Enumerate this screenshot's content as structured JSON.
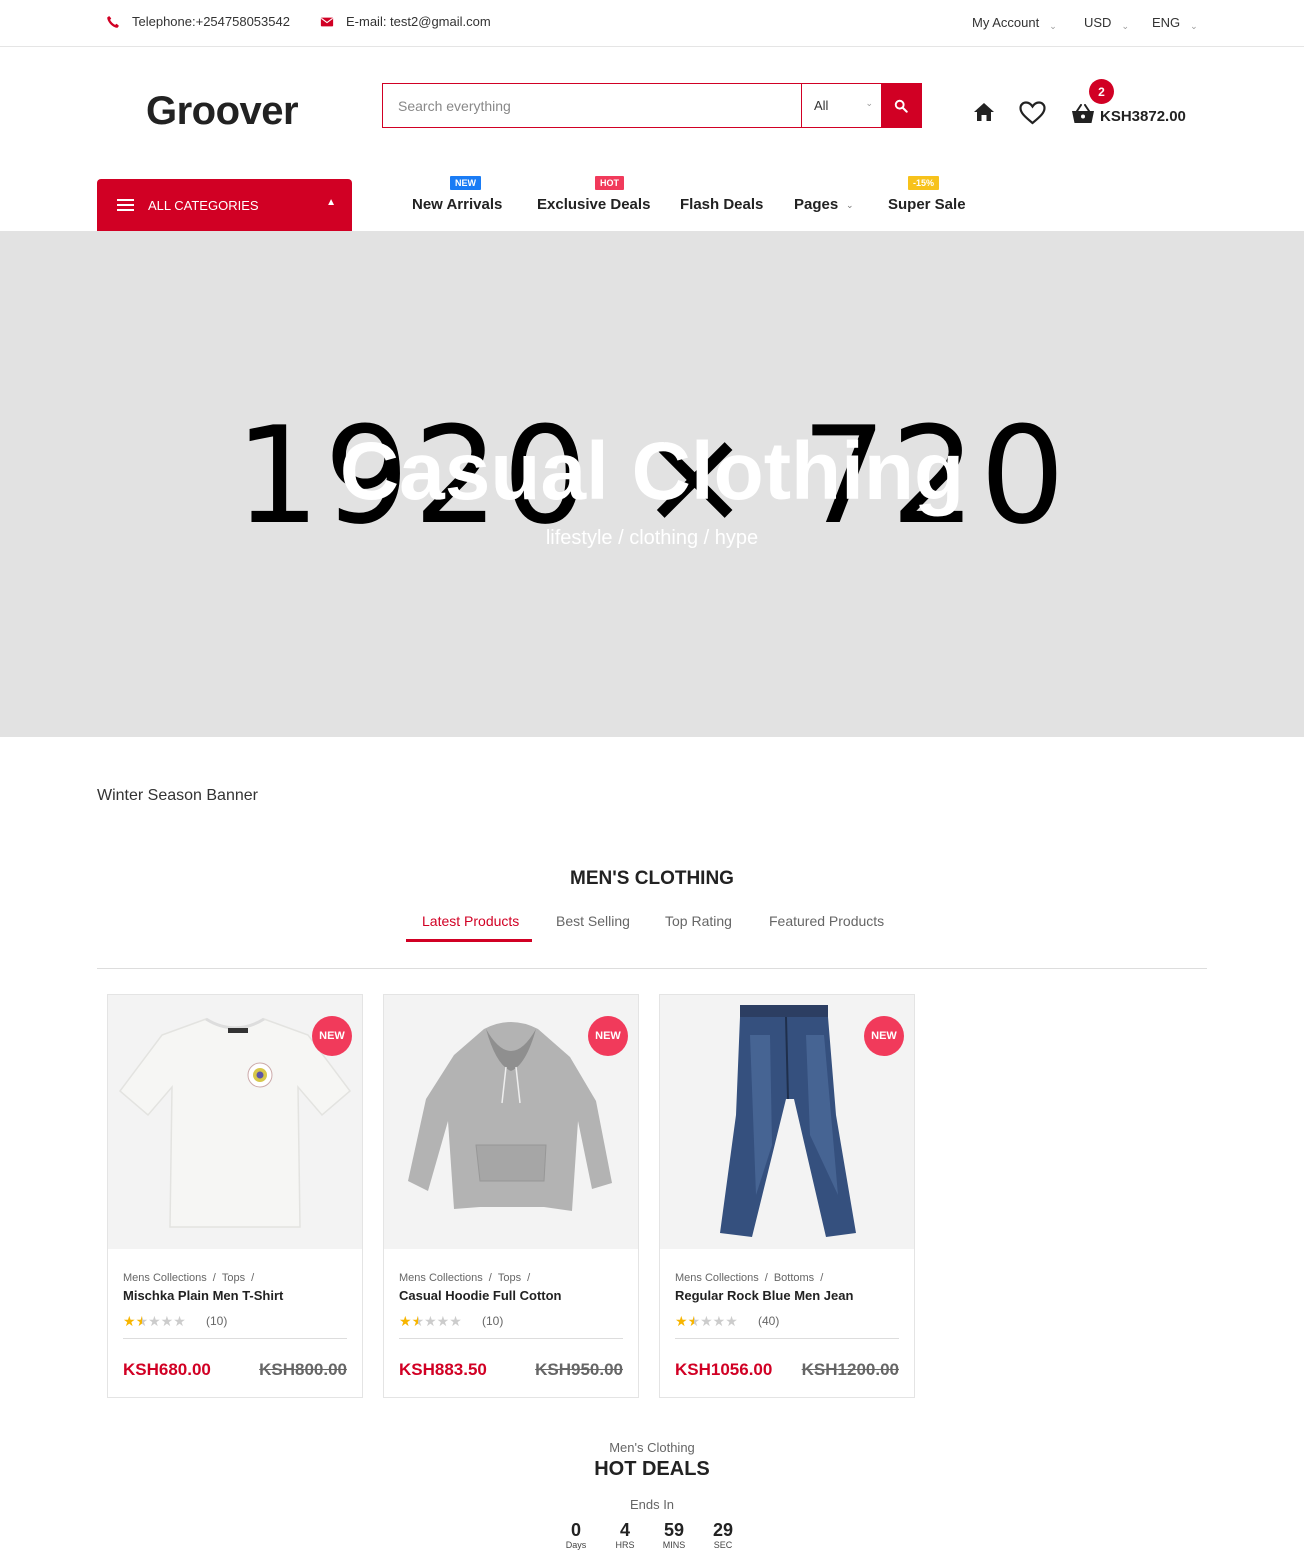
{
  "topbar": {
    "phone": "Telephone:+254758053542",
    "email": "E-mail: test2@gmail.com",
    "account": "My Account",
    "currency": "USD",
    "language": "ENG"
  },
  "header": {
    "logo": "Groover",
    "search_placeholder": "Search everything",
    "search_category": "All",
    "cart_count": "2",
    "cart_total": "KSH3872.00"
  },
  "nav": {
    "all_categories": "ALL CATEGORIES",
    "items": [
      {
        "label": "New Arrivals",
        "tag": "NEW"
      },
      {
        "label": "Exclusive Deals",
        "tag": "HOT"
      },
      {
        "label": "Flash Deals",
        "tag": ""
      },
      {
        "label": "Pages",
        "tag": ""
      },
      {
        "label": "Super Sale",
        "tag": "-15%"
      }
    ]
  },
  "hero": {
    "placeholder_text": "1920 × 720",
    "title": "Casual Clothing",
    "subtitle": "lifestyle / clothing / hype"
  },
  "banner_alt": "Winter Season Banner",
  "section": {
    "title": "MEN'S CLOTHING",
    "tabs": [
      "Latest Products",
      "Best Selling",
      "Top Rating",
      "Featured Products"
    ],
    "active_tab": "Latest Products"
  },
  "products": [
    {
      "badge": "NEW",
      "category": "Mens Collections",
      "subcategory": "Tops",
      "name": "Mischka Plain Men T-Shirt",
      "rating": 1.5,
      "reviews": "(10)",
      "price": "KSH680.00",
      "old_price": "KSH800.00"
    },
    {
      "badge": "NEW",
      "category": "Mens Collections",
      "subcategory": "Tops",
      "name": "Casual Hoodie Full Cotton",
      "rating": 1.5,
      "reviews": "(10)",
      "price": "KSH883.50",
      "old_price": "KSH950.00"
    },
    {
      "badge": "NEW",
      "category": "Mens Collections",
      "subcategory": "Bottoms",
      "name": "Regular Rock Blue Men Jean",
      "rating": 1.5,
      "reviews": "(40)",
      "price": "KSH1056.00",
      "old_price": "KSH1200.00"
    }
  ],
  "deals": {
    "kicker": "Men's Clothing",
    "title": "HOT DEALS",
    "ends_label": "Ends In",
    "countdown": [
      {
        "value": "0",
        "label": "Days"
      },
      {
        "value": "4",
        "label": "HRS"
      },
      {
        "value": "59",
        "label": "MINS"
      },
      {
        "value": "29",
        "label": "SEC"
      }
    ]
  },
  "colors": {
    "accent": "#d10024",
    "badge_pink": "#f13a5b",
    "tag_blue": "#1a7cf5",
    "tag_yellow": "#f7c21b",
    "hero_bg": "#e2e2e2"
  },
  "icons": {
    "phone": "phone-icon",
    "email": "envelope-icon",
    "search": "search-icon",
    "home": "home-icon",
    "wishlist": "heart-icon",
    "cart": "basket-icon",
    "menu": "hamburger-icon"
  }
}
